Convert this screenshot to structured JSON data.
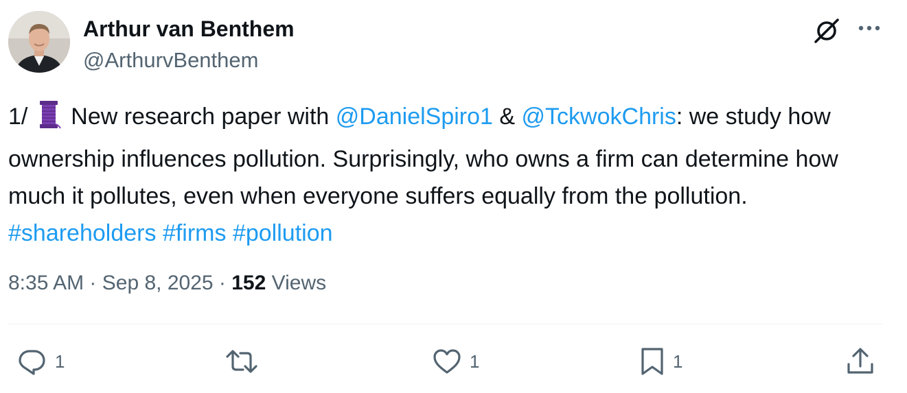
{
  "author": {
    "name": "Arthur van Benthem",
    "handle": "@ArthurvBenthem"
  },
  "tweet": {
    "prefix": "1/",
    "spool_icon": "thread-spool-icon",
    "seg1": " New research paper with ",
    "mention1": "@DanielSpiro1",
    "seg2": " & ",
    "mention2": "@TckwokChris",
    "seg3": ": we study how ownership influences pollution. Surprisingly, who owns a firm can determine how much it pollutes, even when everyone suffers equally from the pollution. ",
    "hashtag1": "#shareholders",
    "hashtag2": "#firms",
    "hashtag3": "#pollution"
  },
  "meta": {
    "time": "8:35 AM",
    "sep1": " · ",
    "date": "Sep 8, 2025",
    "sep2": " · ",
    "views_count": "152",
    "views_label": " Views"
  },
  "actions": {
    "reply_count": "1",
    "repost_count": "",
    "like_count": "1",
    "bookmark_count": "1"
  },
  "colors": {
    "link": "#1d9bf0",
    "secondary_text": "#536471",
    "primary_text": "#0f1419",
    "divider": "#eff3f4"
  }
}
